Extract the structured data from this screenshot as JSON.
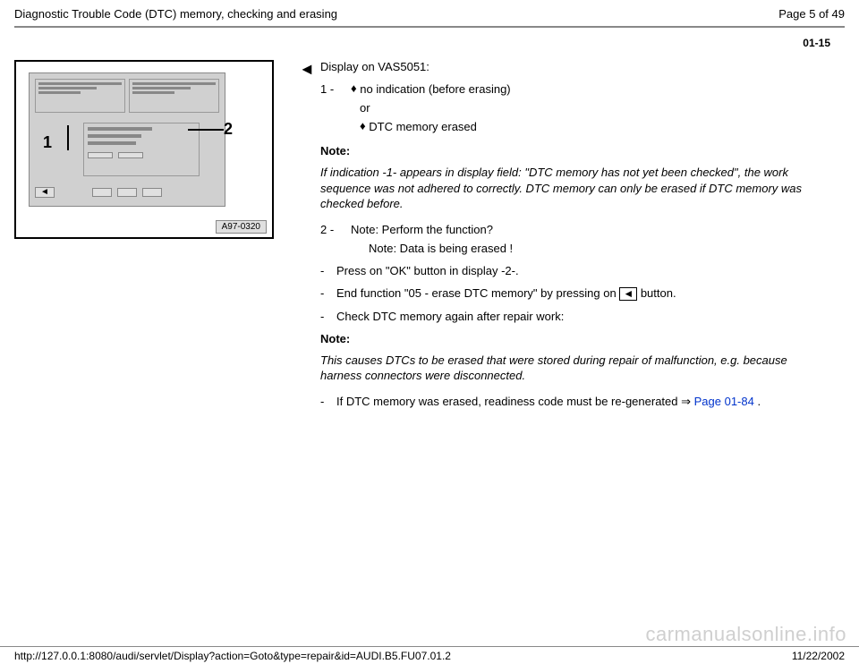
{
  "header": {
    "title": "Diagnostic Trouble Code (DTC) memory, checking and erasing",
    "page_of": "Page 5 of 49"
  },
  "page_code": "01-15",
  "figure": {
    "callout1": "1",
    "callout2": "2",
    "nav_left": "◄",
    "label": "A97-0320"
  },
  "arrow": "◄",
  "lead": "Display on VAS5051:",
  "item1": {
    "num": "1 - ",
    "bullet": "♦",
    "text": " no indication (before erasing)"
  },
  "or": "or",
  "item1b": {
    "bullet": "♦",
    "text": " DTC memory erased"
  },
  "note1_h": "Note:",
  "note1_body": "If indication -1- appears in display field: \"DTC memory has not yet been checked\", the work sequence was not adhered to correctly. DTC memory can only be erased if DTC memory was checked before.",
  "item2": {
    "num": "2 - ",
    "text": "Note: Perform the function?"
  },
  "item2b": "Note: Data is being erased !",
  "step1": "Press on \"OK\" button in display -2-.",
  "step2a": "End function \"05 - erase DTC memory\" by pressing on ",
  "step2btn": "◄",
  "step2b": " button.",
  "step3": "Check DTC memory again after repair work:",
  "note2_h": "Note:",
  "note2_body": "This causes DTCs to be erased that were stored during repair of malfunction, e.g. because harness connectors were disconnected.",
  "step4a": "If DTC memory was erased, readiness code must be re-generated  ⇒ ",
  "step4link": "Page 01-84",
  "step4b": " .",
  "watermark": "carmanualsonline.info",
  "footer": {
    "url": "http://127.0.0.1:8080/audi/servlet/Display?action=Goto&type=repair&id=AUDI.B5.FU07.01.2",
    "date": "11/22/2002"
  }
}
